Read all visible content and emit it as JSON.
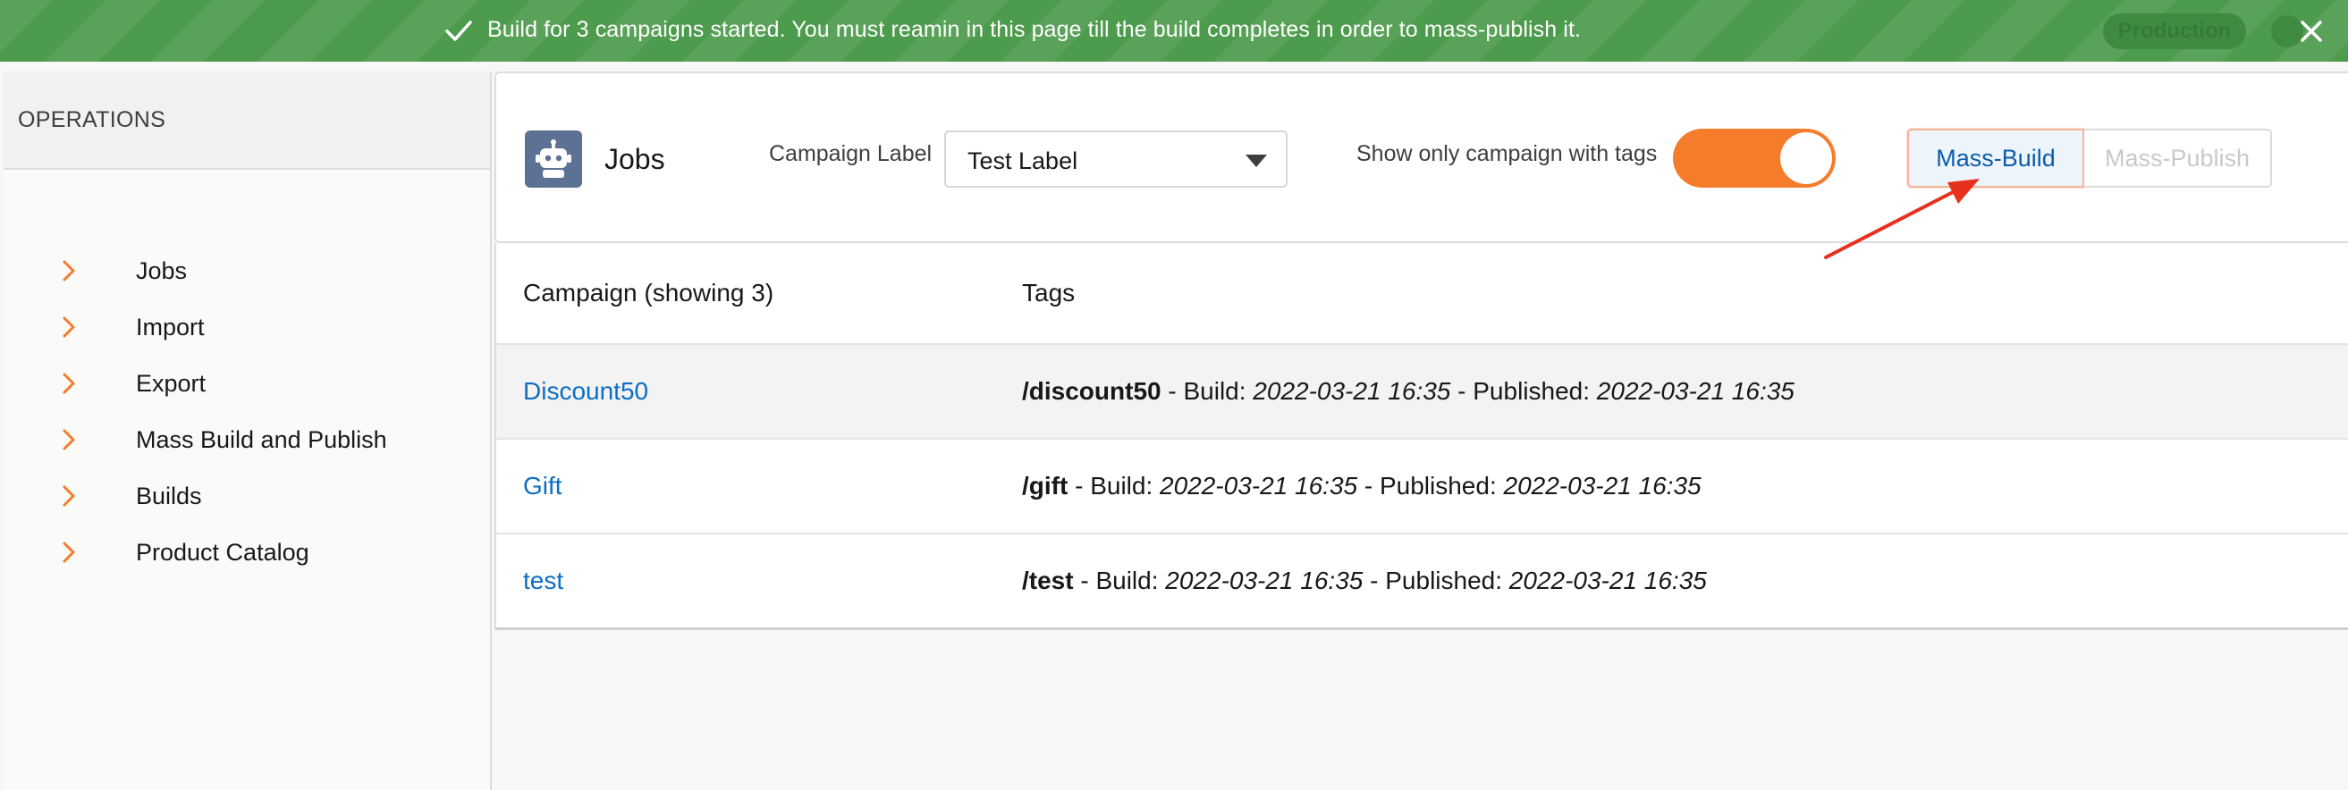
{
  "toast": {
    "message": "Build for 3 campaigns started. You must reamin in this page till the build completes in order to mass-publish it.",
    "env_badge": "Production",
    "color": "#4d9b4d"
  },
  "sidebar": {
    "title": "OPERATIONS",
    "items": [
      {
        "label": "Jobs"
      },
      {
        "label": "Import"
      },
      {
        "label": "Export"
      },
      {
        "label": "Mass Build and Publish"
      },
      {
        "label": "Builds"
      },
      {
        "label": "Product Catalog"
      }
    ],
    "chevron_color": "#f47c2a"
  },
  "header": {
    "title": "Jobs",
    "icon": "robot-icon",
    "campaign_label": "Campaign Label",
    "campaign_value": "Test Label",
    "toggle_label": "Show only campaign with tags",
    "toggle_on": true,
    "toggle_color": "#f47c2a",
    "mass_build": "Mass-Build",
    "mass_publish": "Mass-Publish"
  },
  "table": {
    "headers": [
      "Campaign (showing 3)",
      "Tags"
    ],
    "rows": [
      {
        "campaign": "Discount50",
        "tag": "/discount50",
        "build_label": " - Build: ",
        "build": "2022-03-21 16:35",
        "pub_label": " - Published: ",
        "published": "2022-03-21 16:35"
      },
      {
        "campaign": "Gift",
        "tag": "/gift",
        "build_label": " - Build: ",
        "build": "2022-03-21 16:35",
        "pub_label": " - Published: ",
        "published": "2022-03-21 16:35"
      },
      {
        "campaign": "test",
        "tag": "/test",
        "build_label": " - Build: ",
        "build": "2022-03-21 16:35",
        "pub_label": " - Published: ",
        "published": "2022-03-21 16:35"
      }
    ]
  },
  "annotation": {
    "arrow_color": "#e8301f"
  }
}
